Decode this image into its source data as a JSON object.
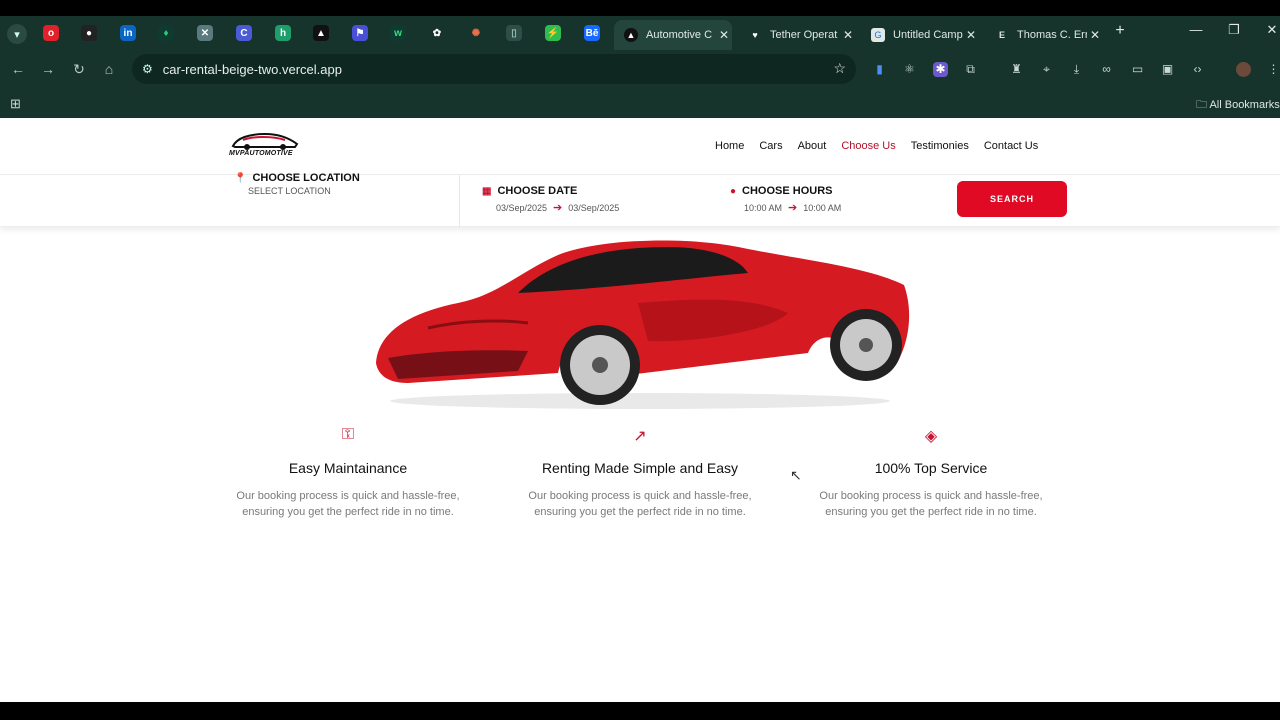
{
  "browser": {
    "tabs": [
      {
        "title": "Automotive C",
        "active": true
      },
      {
        "title": "Tether Operat",
        "active": false
      },
      {
        "title": "Untitled Camp",
        "active": false
      },
      {
        "title": "Thomas C. Err",
        "active": false
      }
    ],
    "new_tab": "+",
    "url": "car-rental-beige-two.vercel.app",
    "bookmarks_label": "All Bookmarks"
  },
  "site": {
    "logo_text": "MVPAUTOMOTIVE",
    "nav": [
      "Home",
      "Cars",
      "About",
      "Choose Us",
      "Testimonies",
      "Contact Us"
    ],
    "active_nav": "Choose Us",
    "search": {
      "location_label": "CHOOSE LOCATION",
      "location_value": "SELECT LOCATION",
      "date_label": "CHOOSE DATE",
      "date_from": "03/Sep/2025",
      "date_to": "03/Sep/2025",
      "hours_label": "CHOOSE HOURS",
      "hours_from": "10:00 AM",
      "hours_to": "10:00 AM",
      "button": "SEARCH"
    },
    "features": [
      {
        "title": "Easy Maintainance",
        "text": "Our booking process is quick and hassle-free, ensuring you get the perfect ride in no time.",
        "icon": "key-icon"
      },
      {
        "title": "Renting Made Simple and Easy",
        "text": "Our booking process is quick and hassle-free, ensuring you get the perfect ride in no time.",
        "icon": "trend-up-icon"
      },
      {
        "title": "100% Top Service",
        "text": "Our booking process is quick and hassle-free, ensuring you get the perfect ride in no time.",
        "icon": "handshake-icon"
      }
    ]
  },
  "colors": {
    "accent": "#e00a25",
    "chrome": "#16332c"
  }
}
